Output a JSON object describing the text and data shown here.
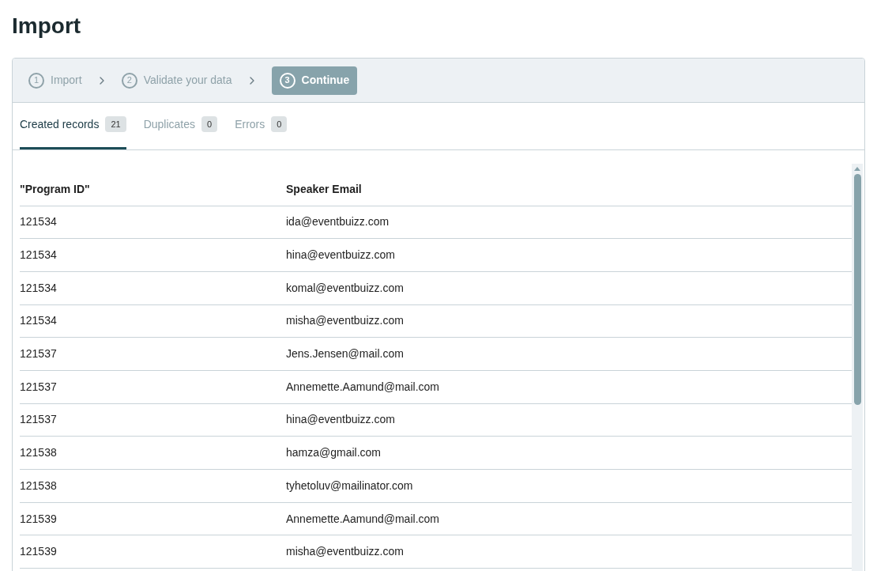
{
  "title": "Import",
  "steps": [
    {
      "number": "1",
      "label": "Import",
      "selected": false
    },
    {
      "number": "2",
      "label": "Validate your data",
      "selected": false
    },
    {
      "number": "3",
      "label": "Continue",
      "selected": true
    }
  ],
  "tabs": [
    {
      "label": "Created records",
      "count": "21",
      "selected": true
    },
    {
      "label": "Duplicates",
      "count": "0",
      "selected": false
    },
    {
      "label": "Errors",
      "count": "0",
      "selected": false
    }
  ],
  "table": {
    "columns": [
      "\"Program ID\"",
      "Speaker Email"
    ],
    "rows": [
      [
        "121534",
        "ida@eventbuizz.com"
      ],
      [
        "121534",
        "hina@eventbuizz.com"
      ],
      [
        "121534",
        "komal@eventbuizz.com"
      ],
      [
        "121534",
        "misha@eventbuizz.com"
      ],
      [
        "121537",
        "Jens.Jensen@mail.com"
      ],
      [
        "121537",
        "Annemette.Aamund@mail.com"
      ],
      [
        "121537",
        "hina@eventbuizz.com"
      ],
      [
        "121538",
        "hamza@gmail.com"
      ],
      [
        "121538",
        "tyhetoluv@mailinator.com"
      ],
      [
        "121539",
        "Annemette.Aamund@mail.com"
      ],
      [
        "121539",
        "misha@eventbuizz.com"
      ]
    ]
  }
}
